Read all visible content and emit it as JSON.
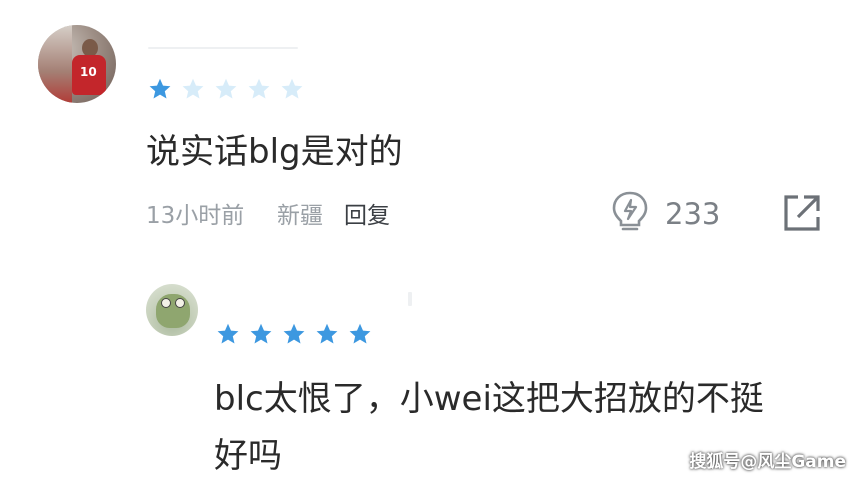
{
  "comment1": {
    "rating": 1,
    "rating_max": 5,
    "text": "说实话blg是对的",
    "time": "13小时前",
    "location": "新疆",
    "reply_label": "回复",
    "like_count": "233"
  },
  "comment2": {
    "rating": 5,
    "rating_max": 5,
    "text_line1": "blc太恨了，小wei这把大招放的不挺",
    "text_line2": "好吗"
  },
  "watermark": "搜狐号@风尘Game",
  "colors": {
    "star_active": "#3d98e0",
    "star_inactive": "#d7ecf9",
    "meta_text": "#9aa0a6",
    "body_text": "#2a2a2a"
  },
  "icons": {
    "like": "lightbulb-like-icon",
    "share": "share-external-icon"
  }
}
